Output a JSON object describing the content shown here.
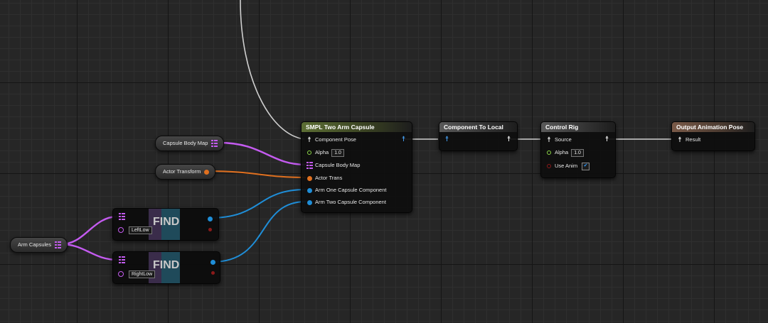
{
  "nodes": {
    "two_arm": {
      "title": "SMPL Two Arm Capsule",
      "pins": [
        "Component Pose",
        "Alpha",
        "Capsule Body Map",
        "Actor Trans",
        "Arm One Capsule Component",
        "Arm Two Capsule Component"
      ],
      "alpha_value": "1.0"
    },
    "comp_to_local": {
      "title": "Component To Local"
    },
    "control_rig": {
      "title": "Control Rig",
      "pins": [
        "Source",
        "Alpha",
        "Use Anim"
      ],
      "alpha_value": "1.0",
      "use_anim_checked": true
    },
    "output_pose": {
      "title": "Output Animation Pose",
      "pins": [
        "Result"
      ]
    },
    "capsule_body_map_var": {
      "label": "Capsule Body Map"
    },
    "actor_transform_var": {
      "label": "Actor Transform"
    },
    "arm_capsules_var": {
      "label": "Arm Capsules"
    },
    "find_left": {
      "title": "FIND",
      "key": "LeftLow"
    },
    "find_right": {
      "title": "FIND",
      "key": "RightLow"
    }
  },
  "colors": {
    "pose_wire": "#cfcfcf",
    "array_wire": "#c45bf0",
    "struct_wire": "#e0701f",
    "object_wire": "#1f8ed8",
    "bool_pin": "#8b1a1a",
    "float_pin": "#8cd645"
  },
  "icons": {
    "pose": "pose-figure-icon",
    "array": "array-grid-icon",
    "float": "float-ring-icon",
    "object": "object-dot-icon",
    "struct": "struct-dot-icon",
    "bool": "bool-ring-icon"
  }
}
